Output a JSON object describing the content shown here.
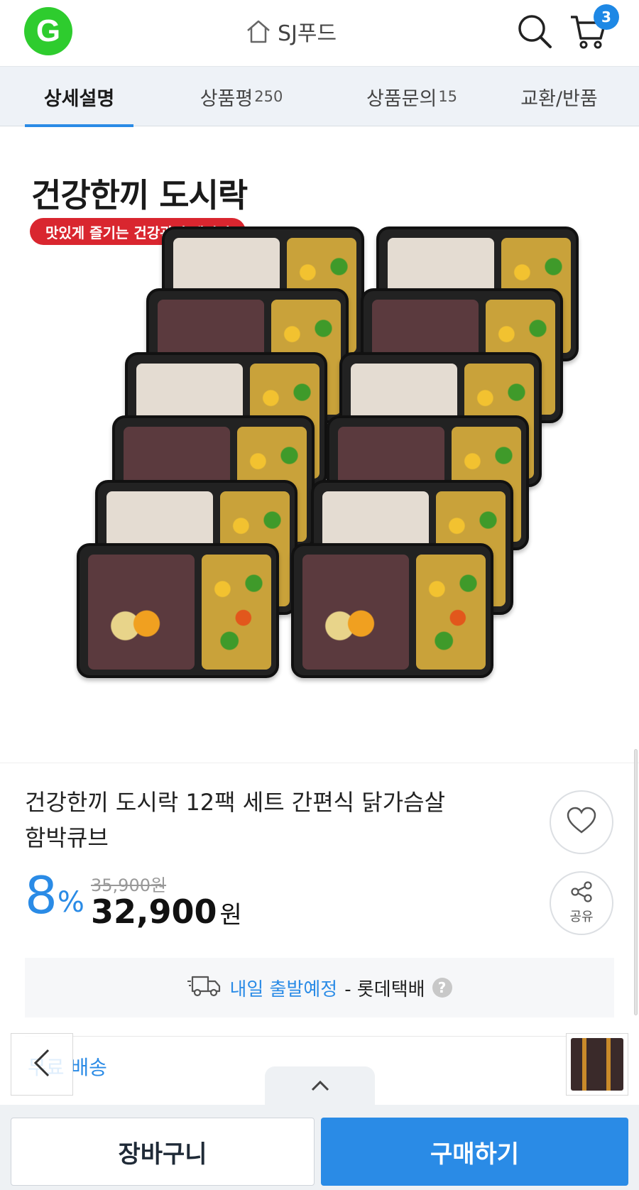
{
  "header": {
    "logo_letter": "G",
    "store_name": "SJ푸드",
    "cart_count": "3"
  },
  "tabs": [
    {
      "label": "상세설명",
      "count": ""
    },
    {
      "label": "상품평",
      "count": "250"
    },
    {
      "label": "상품문의",
      "count": "15"
    },
    {
      "label": "교환/반품",
      "count": ""
    }
  ],
  "hero": {
    "title": "건강한끼 도시락",
    "ribbon": "맛있게 즐기는 건강관리 레시피"
  },
  "product": {
    "title_line1": "건강한끼 도시락 12팩 세트 간편식 닭가슴살",
    "title_line2": "함박큐브",
    "discount_num": "8",
    "discount_pct": "%",
    "original_price": "35,900원",
    "price": "32,900",
    "price_unit": "원",
    "share_label": "공유"
  },
  "delivery": {
    "highlight": "내일 출발예정",
    "rest": "- 롯데택배",
    "help": "?",
    "free_shipping": "무료 배송"
  },
  "actions": {
    "cart": "장바구니",
    "buy": "구매하기"
  },
  "colors": {
    "accent": "#2a8be6",
    "logo": "#2ecc2e",
    "ribbon": "#d9262f"
  }
}
